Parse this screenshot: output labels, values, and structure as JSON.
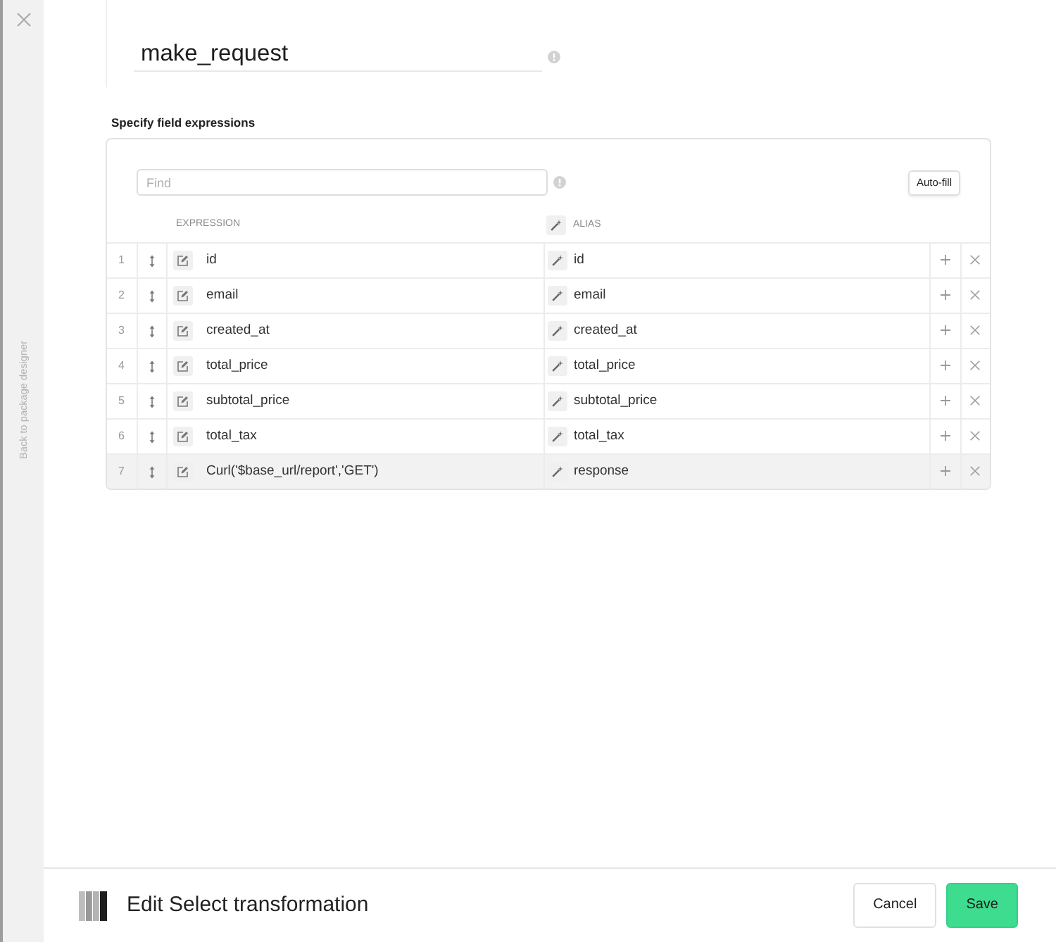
{
  "sidebar": {
    "back_link": "Back to package designer"
  },
  "name_field": {
    "value": "make_request"
  },
  "section_title": "Specify field expressions",
  "find_field": {
    "placeholder": "Find"
  },
  "autofill_button": {
    "label": "Auto-fill"
  },
  "columns": {
    "expression": "EXPRESSION",
    "alias": "ALIAS"
  },
  "rows": [
    {
      "number": "1",
      "expression": "id",
      "alias": "id",
      "selected": false
    },
    {
      "number": "2",
      "expression": "email",
      "alias": "email",
      "selected": false
    },
    {
      "number": "3",
      "expression": "created_at",
      "alias": "created_at",
      "selected": false
    },
    {
      "number": "4",
      "expression": "total_price",
      "alias": "total_price",
      "selected": false
    },
    {
      "number": "5",
      "expression": "subtotal_price",
      "alias": "subtotal_price",
      "selected": false
    },
    {
      "number": "6",
      "expression": "total_tax",
      "alias": "total_tax",
      "selected": false
    },
    {
      "number": "7",
      "expression": "Curl('$base_url/report','GET')",
      "alias": "response",
      "selected": true
    }
  ],
  "footer": {
    "title": "Edit Select transformation",
    "buttons": [
      {
        "label": "Cancel",
        "kind": "secondary"
      },
      {
        "label": "Save",
        "kind": "primary"
      }
    ]
  }
}
